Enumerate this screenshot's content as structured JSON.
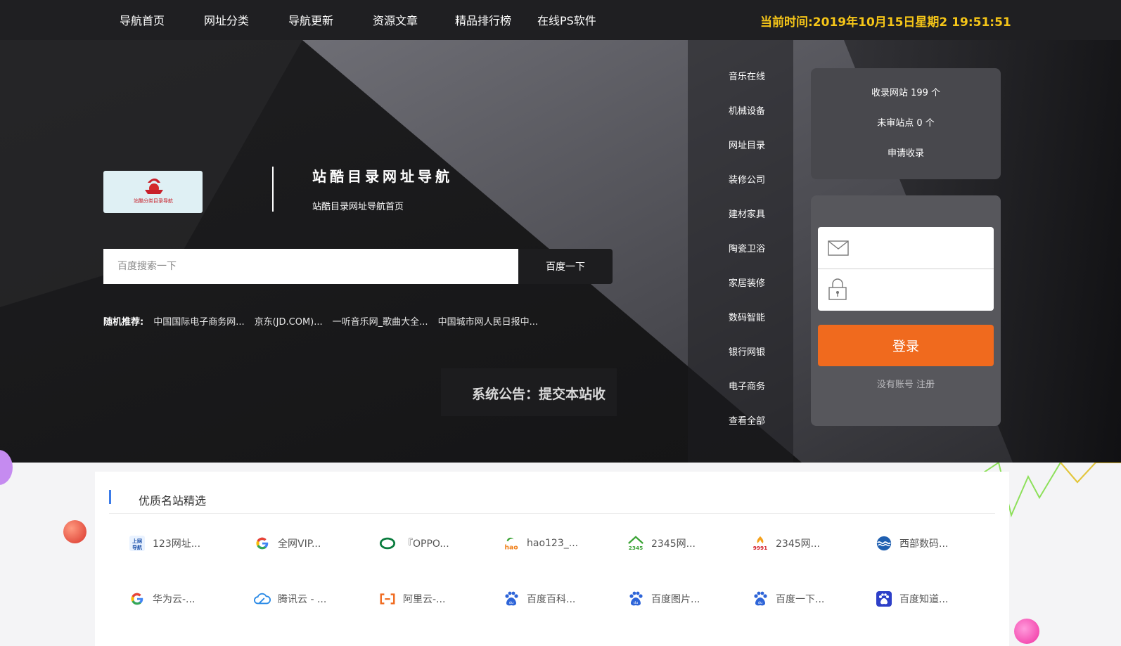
{
  "nav": {
    "items": [
      "导航首页",
      "网址分类",
      "导航更新",
      "资源文章",
      "精品排行榜",
      "在线PS软件"
    ],
    "clock": "当前时间:2019年10月15日星期2 19:51:51"
  },
  "brand": {
    "logo_text": "站酷分类目录导航",
    "title": "站酷目录网址导航",
    "subtitle": "站酷目录网址导航首页"
  },
  "search": {
    "placeholder": "百度搜索一下",
    "button": "百度一下"
  },
  "recommend": {
    "label": "随机推荐:",
    "links": [
      "中国国际电子商务网...",
      "京东(JD.COM)...",
      "一听音乐网_歌曲大全...",
      "中国城市网人民日报中..."
    ]
  },
  "notice": "系统公告：提交本站收",
  "categories": [
    "音乐在线",
    "机械设备",
    "网址目录",
    "装修公司",
    "建材家具",
    "陶瓷卫浴",
    "家居装修",
    "数码智能",
    "银行网银",
    "电子商务",
    "查看全部"
  ],
  "stats": {
    "collected": "收录网站 199 个",
    "pending": "未审站点 0 个",
    "apply": "申请收录"
  },
  "login": {
    "button": "登录",
    "no_account": "没有账号",
    "register": "注册"
  },
  "featured": {
    "title": "优质名站精选",
    "sites": [
      {
        "name": "123网址...",
        "icon": "123-nav-icon"
      },
      {
        "name": "全网VIP...",
        "icon": "google-icon"
      },
      {
        "name": "『OPPO...",
        "icon": "oppo-icon"
      },
      {
        "name": "hao123_...",
        "icon": "hao123-icon"
      },
      {
        "name": "2345网...",
        "icon": "2345-house-icon"
      },
      {
        "name": "2345网...",
        "icon": "9991-icon"
      },
      {
        "name": "西部数码...",
        "icon": "west-digital-icon"
      },
      {
        "name": "华为云-...",
        "icon": "google-icon"
      },
      {
        "name": "腾讯云 - ...",
        "icon": "tencent-cloud-icon"
      },
      {
        "name": "阿里云-...",
        "icon": "aliyun-icon"
      },
      {
        "name": "百度百科...",
        "icon": "baidu-paw-icon"
      },
      {
        "name": "百度图片...",
        "icon": "baidu-paw-icon"
      },
      {
        "name": "百度一下...",
        "icon": "baidu-paw-icon"
      },
      {
        "name": "百度知道...",
        "icon": "baidu-zhidao-icon"
      }
    ]
  },
  "colors": {
    "clock": "#f5c518",
    "login_button": "#f06a1e",
    "section_accent": "#3b7be8"
  }
}
